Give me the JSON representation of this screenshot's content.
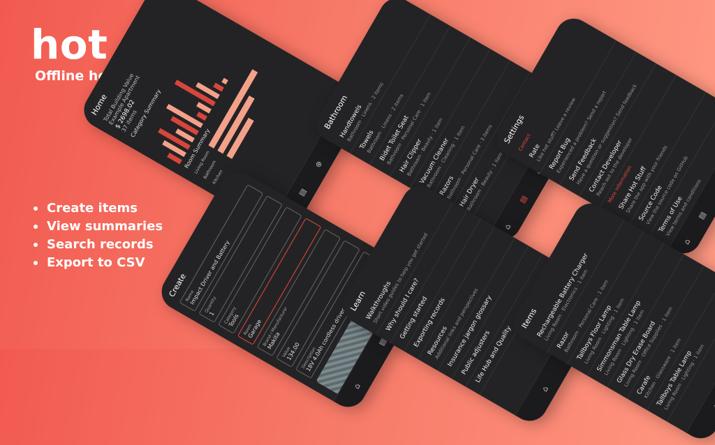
{
  "hero": {
    "title": "hot stuff",
    "subtitle": "Offline home inventory"
  },
  "features": [
    "Create items",
    "View summaries",
    "Search records",
    "Export to CSV"
  ],
  "colors": {
    "accent": "#e84a3f",
    "phone_bg": "#232325",
    "bar_dark": "#d6463c",
    "bar_light": "#f4a18a"
  },
  "home": {
    "title": "Home",
    "value_label": "Total Building Value",
    "home_name": "Example Apartment",
    "total": "$ 2698.02",
    "items": "37 items",
    "category_summary": "Category Summary",
    "item_quantity": "Item Quantity",
    "room_summary": "Room Summary",
    "item_value": "Item Value",
    "rooms": [
      "Living Room",
      "Bathroom",
      "Kitchen"
    ],
    "category_values": [
      3,
      5,
      7,
      4,
      6,
      8,
      2,
      3,
      9,
      5,
      2,
      1
    ],
    "room_values": [
      0.9,
      0.65,
      0.45
    ]
  },
  "bathroom": {
    "title": "Bathroom",
    "subtitle": "Bathroom · Personal Care · 1 item",
    "items": [
      {
        "name": "Handtowels",
        "meta": "Bathroom · Linens · 2 items"
      },
      {
        "name": "Towels",
        "meta": "Bathroom · Linens · 2 items"
      },
      {
        "name": "Bidet Toilet Seat",
        "meta": "Bathroom · Personal Care · 1 item"
      },
      {
        "name": "Hair Clipper",
        "meta": "Bathroom · Beauty · 1 item"
      },
      {
        "name": "Vacuum Cleaner",
        "meta": "Bathroom · Cleaning · 1 item"
      },
      {
        "name": "Razors",
        "meta": "Bathroom · Personal Care · 3 items"
      },
      {
        "name": "Hair Dryer",
        "meta": "Bathroom · Beauty · 1 item"
      }
    ]
  },
  "settings": {
    "title": "Settings",
    "contact": "Contact",
    "rows": [
      {
        "name": "Rate",
        "meta": "Like hot stuff? Leave a review"
      },
      {
        "name": "Report Bug",
        "meta": "Experienced a problem? Send a report"
      },
      {
        "name": "Send Feedback",
        "meta": "Have a question or suggestion? Send feedback"
      },
      {
        "name": "Contact Developer",
        "meta": "Reach out to the developer"
      },
      {
        "name": "Share Hot Stuff",
        "meta": "Share the app with your friends"
      },
      {
        "name": "Source Code",
        "meta": "View the source code on GitHub"
      },
      {
        "name": "Terms of Use",
        "meta": "View terms and conditions"
      }
    ],
    "more_info": "More information"
  },
  "create": {
    "title": "Create",
    "fields": [
      {
        "label": "Name",
        "value": "Impact Driver and Battery"
      },
      {
        "label": "Quantity",
        "value": "1"
      },
      {
        "label": "Category",
        "value": "Tools"
      },
      {
        "label": "Room",
        "value": "Garage"
      },
      {
        "label": "Brand / Manufacturer",
        "value": "Makita"
      },
      {
        "label": "Value",
        "value": "134.00"
      },
      {
        "label": "Description",
        "value": "18V 4.0Ah cordless driver with 18V lithium"
      }
    ]
  },
  "learn": {
    "title": "Learn",
    "sections": [
      {
        "name": "Walkthroughs",
        "meta": "Short video guides to help you get started"
      },
      {
        "name": "Why should I care?",
        "meta": ""
      },
      {
        "name": "Getting started",
        "meta": ""
      },
      {
        "name": "Exporting records",
        "meta": ""
      },
      {
        "name": "Resources",
        "meta": "Additional links and perspectives"
      },
      {
        "name": "Insurance jargon glossary",
        "meta": ""
      },
      {
        "name": "Public adjusters",
        "meta": ""
      },
      {
        "name": "Life Hub and Quality",
        "meta": ""
      }
    ]
  },
  "items": {
    "title": "Items",
    "list": [
      {
        "name": "Rechargeable Battery Charger",
        "meta": "Living Room · Electronics · 1 item"
      },
      {
        "name": "Razor",
        "meta": "Bathroom · Personal Care · 1 item"
      },
      {
        "name": "Tallboys Floor Lamp",
        "meta": "Living Room · Lighting · 1 item"
      },
      {
        "name": "Simmonsman Table Lamp",
        "meta": "Living Room · Lighting · 1 item"
      },
      {
        "name": "Glass Dry Erase Board",
        "meta": "Living Room · Office Supplies · 1 item"
      },
      {
        "name": "Carafe",
        "meta": "Kitchen · Glassware · 1 item"
      },
      {
        "name": "Tallboys Table Lamp",
        "meta": "Living Room · Lighting · 1 item"
      }
    ]
  },
  "nav": [
    "Home",
    "Items",
    "Create",
    "Learn",
    "Settings"
  ]
}
